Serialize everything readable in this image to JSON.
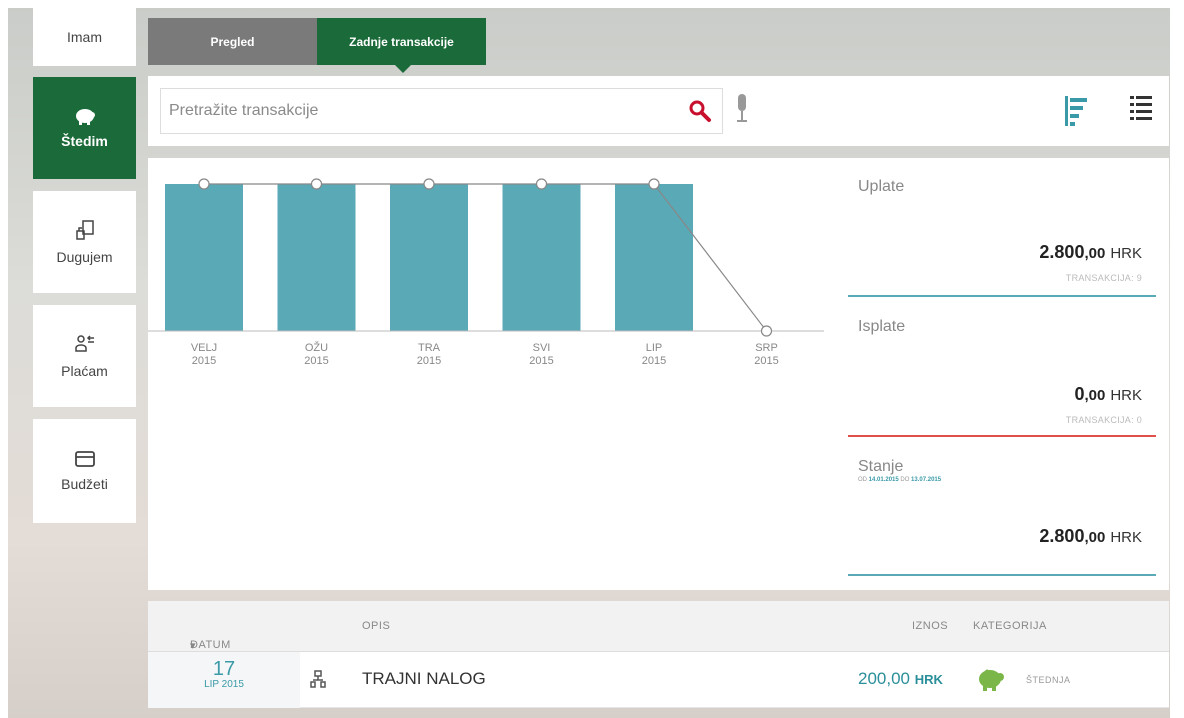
{
  "sidebar": {
    "items": [
      {
        "label": "Imam",
        "icon": "wallet-icon"
      },
      {
        "label": "Štedim",
        "icon": "piggy-bank-icon",
        "active": true
      },
      {
        "label": "Dugujem",
        "icon": "debt-icon"
      },
      {
        "label": "Plaćam",
        "icon": "payments-icon"
      },
      {
        "label": "Budžeti",
        "icon": "card-icon"
      }
    ]
  },
  "tabs": [
    {
      "label": "Pregled",
      "active": false
    },
    {
      "label": "Zadnje transakcije",
      "active": true
    }
  ],
  "search": {
    "placeholder": "Pretražite transakcije"
  },
  "chart_data": {
    "type": "bar",
    "categories": [
      "VELJ 2015",
      "OŽU 2015",
      "TRA 2015",
      "SVI 2015",
      "LIP 2015",
      "SRP 2015"
    ],
    "category_month": [
      "VELJ",
      "OŽU",
      "TRA",
      "SVI",
      "LIP",
      "SRP"
    ],
    "category_year": [
      "2015",
      "2015",
      "2015",
      "2015",
      "2015",
      "2015"
    ],
    "values": [
      1,
      1,
      1,
      1,
      1,
      0
    ],
    "line_values": [
      1,
      1,
      1,
      1,
      1,
      0
    ],
    "bar_color": "#5aa9b6"
  },
  "stats": {
    "uplate": {
      "title": "Uplate",
      "amount": "2.800",
      "decimals": ",00",
      "currency": "HRK",
      "transactions": "TRANSAKCIJA: 9",
      "line_color": "#5aa9b6"
    },
    "isplate": {
      "title": "Isplate",
      "amount": "0",
      "decimals": ",00",
      "currency": "HRK",
      "transactions": "TRANSAKCIJA: 0",
      "line_color": "#e0504a"
    },
    "stanje": {
      "title": "Stanje",
      "range_from_label": "OD",
      "range_from": "14.01.2015",
      "range_to_label": "DO",
      "range_to": "13.07.2015",
      "amount": "2.800",
      "decimals": ",00",
      "currency": "HRK",
      "line_color": "#5aa9b6"
    }
  },
  "table": {
    "headers": {
      "date": "DATUM",
      "description": "OPIS",
      "amount": "IZNOS",
      "category": "KATEGORIJA"
    },
    "rows": [
      {
        "day": "17",
        "month": "LIP 2015",
        "description": "TRAJNI NALOG",
        "amount": "200,00",
        "currency": "HRK",
        "category": "ŠTEDNJA"
      }
    ]
  },
  "colors": {
    "brand_green": "#1b6b3a",
    "accent_teal": "#3a9aa8",
    "search_red": "#c8102e"
  }
}
